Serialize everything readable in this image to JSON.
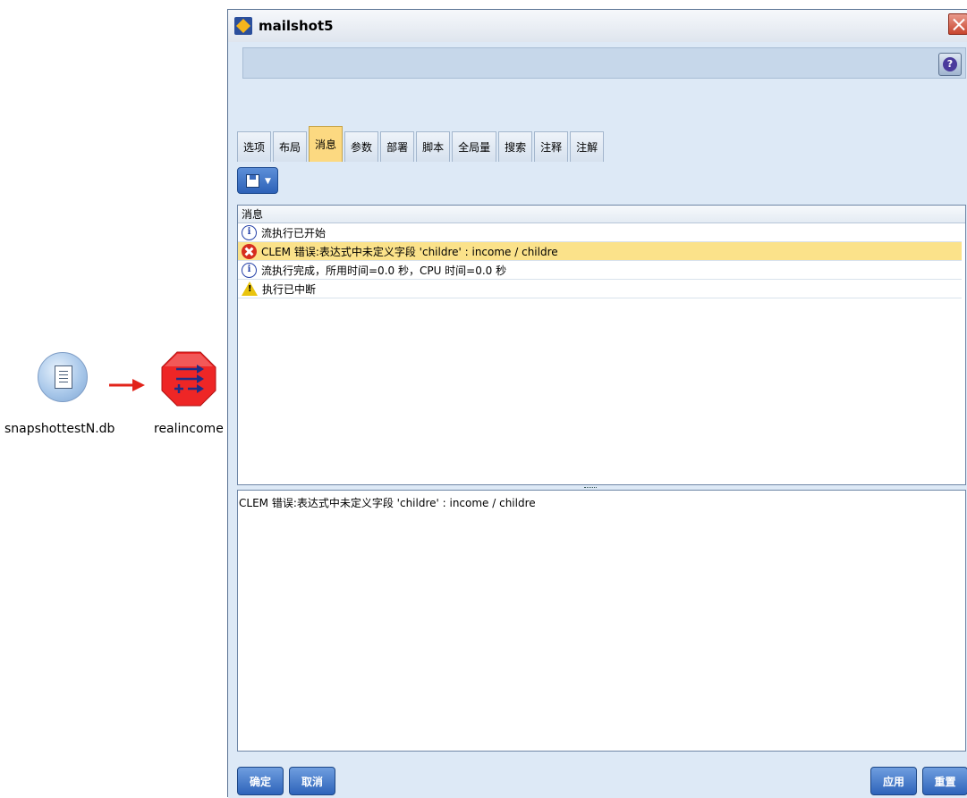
{
  "canvas": {
    "source_node": {
      "label": "snapshottestN.db",
      "icon": "database-file-icon"
    },
    "target_node": {
      "label": "realincome",
      "icon": "derive-node-icon",
      "status_color": "#e81e1e"
    }
  },
  "dialog": {
    "title": "mailshot5",
    "help_label": "?",
    "tabs": [
      {
        "label": "选项"
      },
      {
        "label": "布局"
      },
      {
        "label": "消息"
      },
      {
        "label": "参数"
      },
      {
        "label": "部署"
      },
      {
        "label": "脚本"
      },
      {
        "label": "全局量"
      },
      {
        "label": "搜索"
      },
      {
        "label": "注释"
      },
      {
        "label": "注解"
      }
    ],
    "active_tab": "消息",
    "messages": {
      "column_header": "消息",
      "rows": [
        {
          "type": "info",
          "text": "流执行已开始"
        },
        {
          "type": "error",
          "text": "CLEM 错误:表达式中未定义字段 'childre' : income / childre",
          "selected": true
        },
        {
          "type": "info",
          "text": "流执行完成，所用时间=0.0 秒，CPU 时间=0.0 秒"
        },
        {
          "type": "warning",
          "text": "执行已中断"
        }
      ],
      "detail_text": "CLEM 错误:表达式中未定义字段 'childre' : income / childre"
    },
    "buttons": {
      "ok": "确定",
      "cancel": "取消",
      "apply": "应用",
      "reset": "重置"
    }
  },
  "colors": {
    "dialog_bg": "#dde9f6",
    "selected_row": "#fbe28a",
    "active_tab": "#fcd981",
    "button_blue": "#2e63ba",
    "error_red": "#d62d1f"
  }
}
